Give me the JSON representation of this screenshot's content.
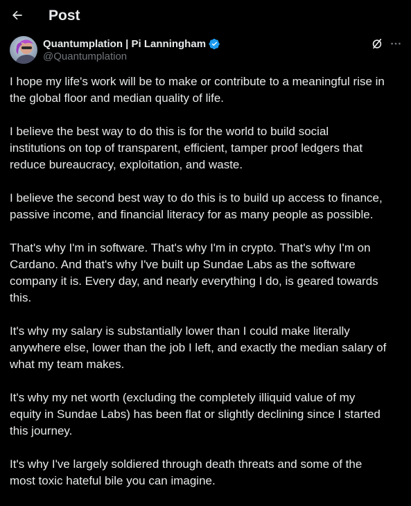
{
  "header": {
    "title": "Post",
    "back_icon": "arrow-left-icon"
  },
  "author": {
    "display_name": "Quantumplation | Pi Lanningham",
    "handle": "@Quantumplation",
    "verified": true,
    "verified_color": "#1d9bf0",
    "avatar_icon": "avatar-image"
  },
  "actions": {
    "grok_icon": "grok-icon",
    "more_icon": "more-options-icon"
  },
  "post": {
    "paragraphs": [
      "I hope my life's work will be to make or contribute to a meaningful rise in\nthe global floor and median quality of life.",
      "I believe the best way to do this is for the world to build social\ninstitutions on top of transparent, efficient, tamper proof ledgers that\nreduce bureaucracy, exploitation, and waste.",
      "I believe the second best way to do this is to build up access to finance,\npassive income, and financial literacy for as many people as possible.",
      "That's why I'm in software. That's why I'm in crypto. That's why I'm on\nCardano. And that's why I've built up Sundae Labs as the software\ncompany it is. Every day, and nearly everything I do, is geared towards\nthis.",
      "It's why my salary is substantially lower than I could make literally\nanywhere else, lower than the job I left, and exactly the median salary of\nwhat my team makes.",
      "It's why my net worth (excluding the completely illiquid value of my\nequity in Sundae Labs) has been flat or slightly declining since I started\nthis journey.",
      "It's why I've largely soldiered through death threats and some of the\nmost toxic hateful bile you can imagine."
    ]
  },
  "colors": {
    "background": "#000000",
    "text_primary": "#e7e9ea",
    "text_secondary": "#71767b",
    "accent": "#1d9bf0"
  }
}
